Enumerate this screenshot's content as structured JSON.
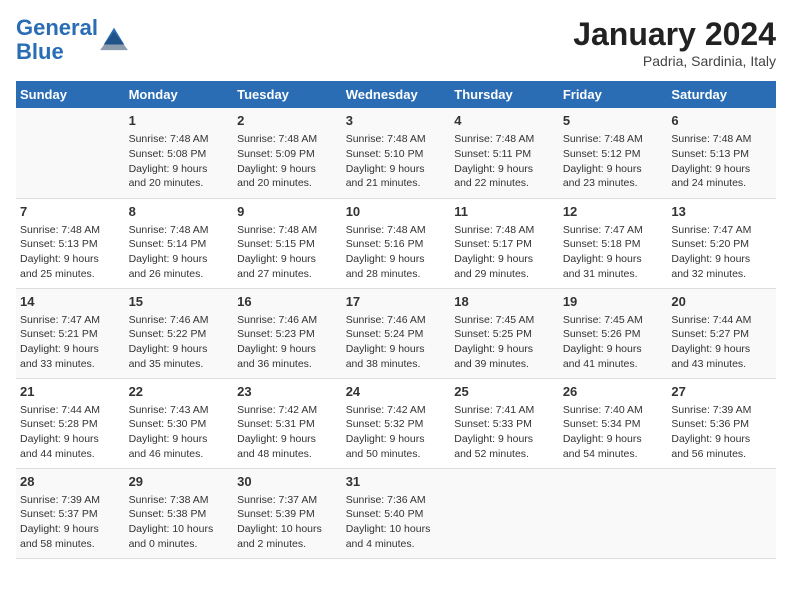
{
  "header": {
    "logo_line1": "General",
    "logo_line2": "Blue",
    "main_title": "January 2024",
    "subtitle": "Padria, Sardinia, Italy"
  },
  "days_of_week": [
    "Sunday",
    "Monday",
    "Tuesday",
    "Wednesday",
    "Thursday",
    "Friday",
    "Saturday"
  ],
  "weeks": [
    [
      {
        "day": "",
        "info": ""
      },
      {
        "day": "1",
        "info": "Sunrise: 7:48 AM\nSunset: 5:08 PM\nDaylight: 9 hours\nand 20 minutes."
      },
      {
        "day": "2",
        "info": "Sunrise: 7:48 AM\nSunset: 5:09 PM\nDaylight: 9 hours\nand 20 minutes."
      },
      {
        "day": "3",
        "info": "Sunrise: 7:48 AM\nSunset: 5:10 PM\nDaylight: 9 hours\nand 21 minutes."
      },
      {
        "day": "4",
        "info": "Sunrise: 7:48 AM\nSunset: 5:11 PM\nDaylight: 9 hours\nand 22 minutes."
      },
      {
        "day": "5",
        "info": "Sunrise: 7:48 AM\nSunset: 5:12 PM\nDaylight: 9 hours\nand 23 minutes."
      },
      {
        "day": "6",
        "info": "Sunrise: 7:48 AM\nSunset: 5:13 PM\nDaylight: 9 hours\nand 24 minutes."
      }
    ],
    [
      {
        "day": "7",
        "info": "Sunrise: 7:48 AM\nSunset: 5:13 PM\nDaylight: 9 hours\nand 25 minutes."
      },
      {
        "day": "8",
        "info": "Sunrise: 7:48 AM\nSunset: 5:14 PM\nDaylight: 9 hours\nand 26 minutes."
      },
      {
        "day": "9",
        "info": "Sunrise: 7:48 AM\nSunset: 5:15 PM\nDaylight: 9 hours\nand 27 minutes."
      },
      {
        "day": "10",
        "info": "Sunrise: 7:48 AM\nSunset: 5:16 PM\nDaylight: 9 hours\nand 28 minutes."
      },
      {
        "day": "11",
        "info": "Sunrise: 7:48 AM\nSunset: 5:17 PM\nDaylight: 9 hours\nand 29 minutes."
      },
      {
        "day": "12",
        "info": "Sunrise: 7:47 AM\nSunset: 5:18 PM\nDaylight: 9 hours\nand 31 minutes."
      },
      {
        "day": "13",
        "info": "Sunrise: 7:47 AM\nSunset: 5:20 PM\nDaylight: 9 hours\nand 32 minutes."
      }
    ],
    [
      {
        "day": "14",
        "info": "Sunrise: 7:47 AM\nSunset: 5:21 PM\nDaylight: 9 hours\nand 33 minutes."
      },
      {
        "day": "15",
        "info": "Sunrise: 7:46 AM\nSunset: 5:22 PM\nDaylight: 9 hours\nand 35 minutes."
      },
      {
        "day": "16",
        "info": "Sunrise: 7:46 AM\nSunset: 5:23 PM\nDaylight: 9 hours\nand 36 minutes."
      },
      {
        "day": "17",
        "info": "Sunrise: 7:46 AM\nSunset: 5:24 PM\nDaylight: 9 hours\nand 38 minutes."
      },
      {
        "day": "18",
        "info": "Sunrise: 7:45 AM\nSunset: 5:25 PM\nDaylight: 9 hours\nand 39 minutes."
      },
      {
        "day": "19",
        "info": "Sunrise: 7:45 AM\nSunset: 5:26 PM\nDaylight: 9 hours\nand 41 minutes."
      },
      {
        "day": "20",
        "info": "Sunrise: 7:44 AM\nSunset: 5:27 PM\nDaylight: 9 hours\nand 43 minutes."
      }
    ],
    [
      {
        "day": "21",
        "info": "Sunrise: 7:44 AM\nSunset: 5:28 PM\nDaylight: 9 hours\nand 44 minutes."
      },
      {
        "day": "22",
        "info": "Sunrise: 7:43 AM\nSunset: 5:30 PM\nDaylight: 9 hours\nand 46 minutes."
      },
      {
        "day": "23",
        "info": "Sunrise: 7:42 AM\nSunset: 5:31 PM\nDaylight: 9 hours\nand 48 minutes."
      },
      {
        "day": "24",
        "info": "Sunrise: 7:42 AM\nSunset: 5:32 PM\nDaylight: 9 hours\nand 50 minutes."
      },
      {
        "day": "25",
        "info": "Sunrise: 7:41 AM\nSunset: 5:33 PM\nDaylight: 9 hours\nand 52 minutes."
      },
      {
        "day": "26",
        "info": "Sunrise: 7:40 AM\nSunset: 5:34 PM\nDaylight: 9 hours\nand 54 minutes."
      },
      {
        "day": "27",
        "info": "Sunrise: 7:39 AM\nSunset: 5:36 PM\nDaylight: 9 hours\nand 56 minutes."
      }
    ],
    [
      {
        "day": "28",
        "info": "Sunrise: 7:39 AM\nSunset: 5:37 PM\nDaylight: 9 hours\nand 58 minutes."
      },
      {
        "day": "29",
        "info": "Sunrise: 7:38 AM\nSunset: 5:38 PM\nDaylight: 10 hours\nand 0 minutes."
      },
      {
        "day": "30",
        "info": "Sunrise: 7:37 AM\nSunset: 5:39 PM\nDaylight: 10 hours\nand 2 minutes."
      },
      {
        "day": "31",
        "info": "Sunrise: 7:36 AM\nSunset: 5:40 PM\nDaylight: 10 hours\nand 4 minutes."
      },
      {
        "day": "",
        "info": ""
      },
      {
        "day": "",
        "info": ""
      },
      {
        "day": "",
        "info": ""
      }
    ]
  ]
}
